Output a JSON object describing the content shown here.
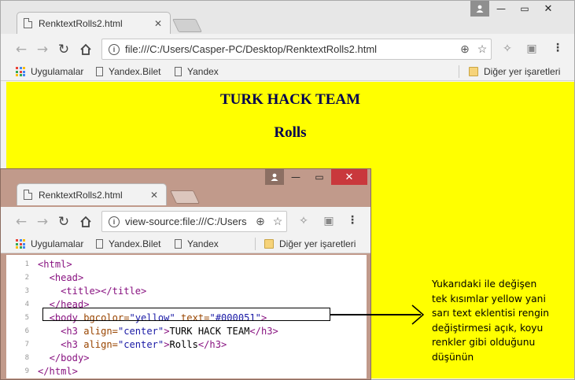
{
  "back_window": {
    "tab_title": "RenktextRolls2.html",
    "url": "file:///C:/Users/Casper-PC/Desktop/RenktextRolls2.html",
    "bookmarks": [
      "Uygulamalar",
      "Yandex.Bilet",
      "Yandex"
    ],
    "other_bookmarks": "Diğer yer işaretleri",
    "heading1": "TURK HACK TEAM",
    "heading2": "Rolls",
    "page_bgcolor": "#ffff00"
  },
  "front_window": {
    "tab_title": "RenktextRolls2.html",
    "url": "view-source:file:///C:/Users",
    "bookmarks": [
      "Uygulamalar",
      "Yandex.Bilet",
      "Yandex"
    ],
    "other_bookmarks": "Diğer yer işaretleri",
    "frame_color": "#c19a8b",
    "close_color": "#c9383c",
    "source_lines": [
      {
        "num": "1",
        "parts": [
          [
            "tag",
            "<html>"
          ]
        ]
      },
      {
        "num": "2",
        "parts": [
          [
            "sp",
            "  "
          ],
          [
            "tag",
            "<head>"
          ]
        ]
      },
      {
        "num": "3",
        "parts": [
          [
            "sp",
            "    "
          ],
          [
            "tag",
            "<title></title>"
          ]
        ]
      },
      {
        "num": "4",
        "parts": [
          [
            "sp",
            "  "
          ],
          [
            "tag",
            "</head>"
          ]
        ]
      },
      {
        "num": "5",
        "parts": [
          [
            "sp",
            "  "
          ],
          [
            "tag",
            "<body "
          ],
          [
            "attr",
            "bgcolor="
          ],
          [
            "val",
            "\"yellow\""
          ],
          [
            "tag",
            " "
          ],
          [
            "attr",
            "text="
          ],
          [
            "val",
            "\"#000051\""
          ],
          [
            "tag",
            ">"
          ]
        ]
      },
      {
        "num": "6",
        "parts": [
          [
            "sp",
            "    "
          ],
          [
            "tag",
            "<h3 "
          ],
          [
            "attr",
            "align="
          ],
          [
            "val",
            "\"center\""
          ],
          [
            "tag",
            ">"
          ],
          [
            "txt",
            "TURK HACK TEAM"
          ],
          [
            "tag",
            "</h3>"
          ]
        ]
      },
      {
        "num": "7",
        "parts": [
          [
            "sp",
            "    "
          ],
          [
            "tag",
            "<h3 "
          ],
          [
            "attr",
            "align="
          ],
          [
            "val",
            "\"center\""
          ],
          [
            "tag",
            ">"
          ],
          [
            "txt",
            "Rolls"
          ],
          [
            "tag",
            "</h3>"
          ]
        ]
      },
      {
        "num": "8",
        "parts": [
          [
            "sp",
            "  "
          ],
          [
            "tag",
            "</body>"
          ]
        ]
      },
      {
        "num": "9",
        "parts": [
          [
            "tag",
            "</html>"
          ]
        ]
      }
    ]
  },
  "annotation": {
    "note_lines": [
      "Yukarıdaki ile değişen",
      "tek kısımlar yellow yani",
      "sarı text eklentisi rengin",
      "değiştirmesi açık, koyu",
      "renkler gibi olduğunu",
      "düşünün"
    ]
  },
  "icons": {
    "back": "arrow-left-icon",
    "forward": "arrow-right-icon",
    "reload": "reload-icon",
    "home": "home-icon",
    "info": "info-icon",
    "zoom": "zoom-icon",
    "star": "star-icon",
    "menu": "kebab-menu-icon"
  }
}
